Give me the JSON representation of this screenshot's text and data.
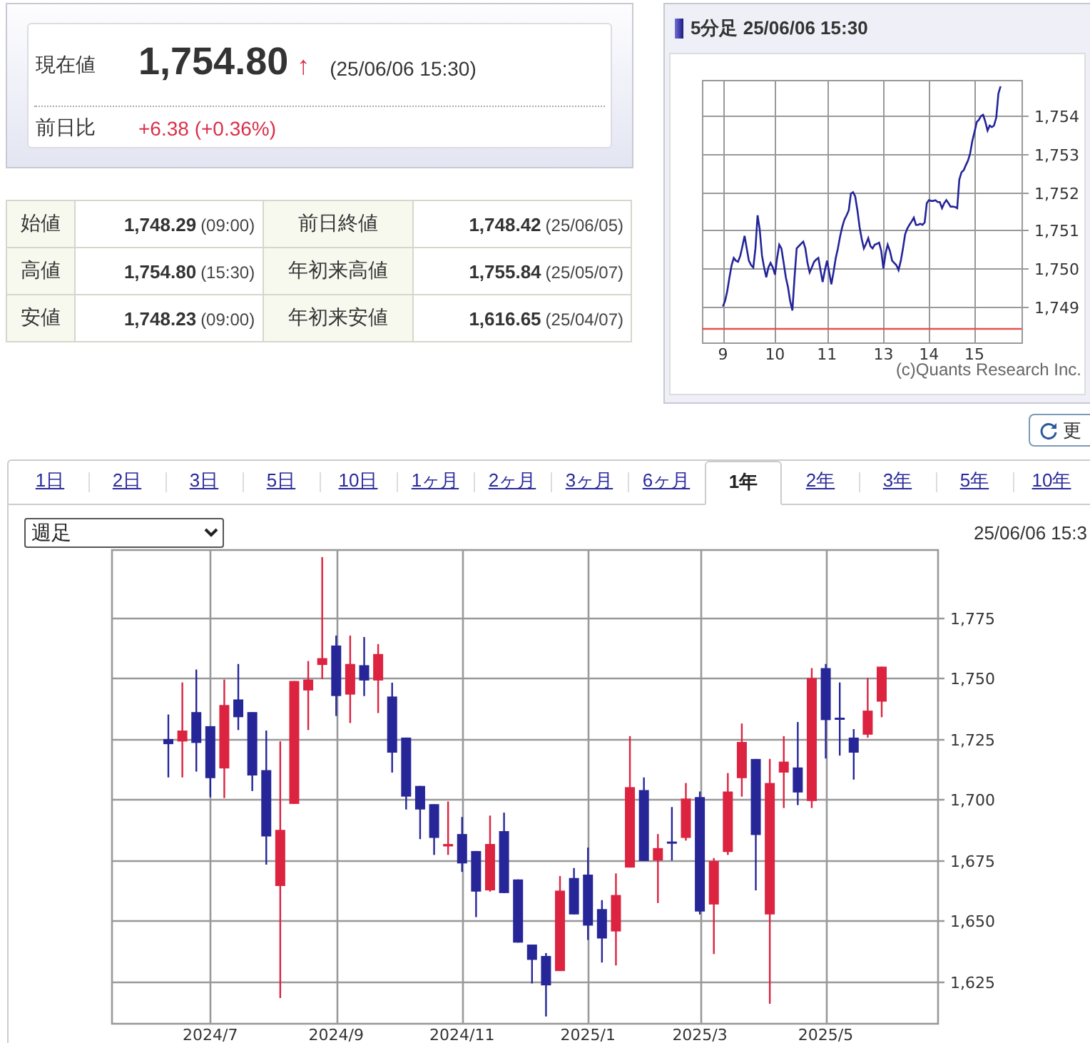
{
  "quote": {
    "label": "現在値",
    "price": "1,754.80",
    "arrow": "↑",
    "time": "(25/06/06 15:30)",
    "change_label": "前日比",
    "change": "+6.38 (+0.36%)"
  },
  "stats": [
    {
      "cells": [
        {
          "label": "始値",
          "value": "1,748.29",
          "time": "(09:00)"
        },
        {
          "label": "前日終値",
          "value": "1,748.42",
          "time": "(25/06/05)"
        }
      ]
    },
    {
      "cells": [
        {
          "label": "高値",
          "value": "1,754.80",
          "time": "(15:30)"
        },
        {
          "label": "年初来高値",
          "value": "1,755.84",
          "time": "(25/05/07)"
        }
      ]
    },
    {
      "cells": [
        {
          "label": "安値",
          "value": "1,748.23",
          "time": "(09:00)"
        },
        {
          "label": "年初来安値",
          "value": "1,616.65",
          "time": "(25/04/07)"
        }
      ]
    }
  ],
  "intraday": {
    "title": "5分足 25/06/06 15:30",
    "copyright": "(c)Quants Research Inc.",
    "chart_data": {
      "type": "line",
      "categories": [
        "9",
        null,
        null,
        null,
        null,
        null,
        null,
        null,
        null,
        null,
        null,
        null,
        null,
        null,
        null,
        null,
        null,
        null,
        null,
        null,
        null,
        null,
        null,
        null,
        "10",
        null,
        null,
        null,
        null,
        null,
        null,
        null,
        null,
        null,
        null,
        null,
        null,
        null,
        null,
        null,
        null,
        null,
        null,
        null,
        null,
        null,
        null,
        null,
        "11",
        null,
        null,
        null,
        null,
        null,
        null,
        null,
        null,
        null,
        null,
        null,
        null,
        null,
        null,
        null,
        null,
        null,
        null,
        null,
        null,
        null,
        null,
        null,
        null,
        null,
        "13",
        null,
        null,
        null,
        null,
        null,
        null,
        null,
        null,
        null,
        null,
        null,
        null,
        null,
        null,
        null,
        null,
        null,
        null,
        null,
        null,
        "14",
        null,
        null,
        null,
        null,
        null,
        null,
        null,
        null,
        null,
        null,
        null,
        null,
        null,
        null,
        null,
        null,
        null,
        null,
        null,
        null,
        "15",
        null,
        null,
        null,
        null,
        null,
        null,
        null,
        null,
        null,
        null,
        null,
        null
      ],
      "values": [
        1749.0,
        1749.14,
        1749.39,
        1749.76,
        1750.08,
        1750.27,
        1750.2,
        1750.17,
        1750.33,
        1750.58,
        1750.85,
        1750.52,
        1750.2,
        1750.08,
        1750.02,
        1750.52,
        1751.39,
        1751.02,
        1750.33,
        1750.02,
        1749.76,
        1750.02,
        1750.14,
        1750.02,
        1749.83,
        1750.27,
        1750.62,
        1750.52,
        1750.14,
        1749.76,
        1749.51,
        1749.14,
        1748.89,
        1749.76,
        1750.52,
        1750.58,
        1750.64,
        1750.7,
        1750.52,
        1750.14,
        1749.89,
        1750.02,
        1750.17,
        1750.23,
        1750.27,
        1749.95,
        1749.64,
        1749.95,
        1750.2,
        1749.89,
        1749.58,
        1749.89,
        1750.27,
        1750.52,
        1750.83,
        1751.08,
        1751.27,
        1751.39,
        1751.52,
        1751.96,
        1752.0,
        1751.89,
        1751.52,
        1751.08,
        1750.77,
        1750.52,
        1750.64,
        1750.79,
        1750.58,
        1750.52,
        1750.62,
        1750.64,
        1750.67,
        1750.45,
        1749.99,
        1750.39,
        1750.62,
        1750.45,
        1750.2,
        1750.14,
        1750.08,
        1749.95,
        1750.2,
        1750.52,
        1750.89,
        1751.04,
        1751.14,
        1751.23,
        1751.33,
        1751.14,
        1751.14,
        1751.17,
        1751.14,
        1751.2,
        1751.71,
        1751.79,
        1751.77,
        1751.77,
        1751.79,
        1751.74,
        1751.74,
        1751.58,
        1751.71,
        1751.79,
        1751.71,
        1751.62,
        1751.62,
        1751.61,
        1751.58,
        1752.33,
        1752.52,
        1752.58,
        1752.71,
        1752.83,
        1753.02,
        1753.34,
        1753.59,
        1753.84,
        1753.9,
        1754.0,
        1754.03,
        1753.84,
        1753.62,
        1753.75,
        1753.71,
        1753.75,
        1753.96,
        1754.59,
        1754.78
      ],
      "ylim": [
        1748.05,
        1754.95
      ],
      "grid": true,
      "yticks": [
        {
          "value": 1749,
          "label": "1,749"
        },
        {
          "value": 1750,
          "label": "1,750"
        },
        {
          "value": 1751,
          "label": "1,751"
        },
        {
          "value": 1752,
          "label": "1,752"
        },
        {
          "value": 1753,
          "label": "1,753"
        },
        {
          "value": 1754,
          "label": "1,754"
        }
      ],
      "ref_lines": [
        {
          "axis": "y",
          "value": 1748.42,
          "color": "#e85050"
        }
      ]
    }
  },
  "refresh_button": "更",
  "period_tabs": [
    {
      "label": "1日",
      "selected": false
    },
    {
      "label": "2日",
      "selected": false
    },
    {
      "label": "3日",
      "selected": false
    },
    {
      "label": "5日",
      "selected": false
    },
    {
      "label": "10日",
      "selected": false
    },
    {
      "label": "1ヶ月",
      "selected": false
    },
    {
      "label": "2ヶ月",
      "selected": false
    },
    {
      "label": "3ヶ月",
      "selected": false
    },
    {
      "label": "6ヶ月",
      "selected": false
    },
    {
      "label": "1年",
      "selected": true
    },
    {
      "label": "2年",
      "selected": false
    },
    {
      "label": "3年",
      "selected": false
    },
    {
      "label": "5年",
      "selected": false
    },
    {
      "label": "10年",
      "selected": false
    }
  ],
  "interval_select": {
    "value": "週足"
  },
  "timestamp": "25/06/06 15:3",
  "chart_data": {
    "type": "candlestick",
    "categories": [
      null,
      null,
      null,
      "2024/7",
      null,
      null,
      null,
      null,
      null,
      null,
      null,
      null,
      "2024/9",
      null,
      null,
      null,
      null,
      null,
      null,
      null,
      null,
      "2024/11",
      null,
      null,
      null,
      null,
      null,
      null,
      null,
      null,
      "2025/1",
      null,
      null,
      null,
      null,
      null,
      null,
      null,
      "2025/3",
      null,
      null,
      null,
      null,
      null,
      null,
      null,
      null,
      "2025/5",
      null,
      null,
      null,
      null
    ],
    "ohlc": [
      [
        1724.9,
        1735.0,
        1709.1,
        1722.8
      ],
      [
        1723.9,
        1748.2,
        1709.1,
        1728.4
      ],
      [
        1736.0,
        1753.5,
        1711.5,
        1723.3
      ],
      [
        1730.2,
        1730.2,
        1701.0,
        1708.8
      ],
      [
        1712.8,
        1749.4,
        1700.6,
        1738.9
      ],
      [
        1741.2,
        1755.8,
        1728.6,
        1733.9
      ],
      [
        1736.0,
        1736.0,
        1703.5,
        1709.9
      ],
      [
        1712.1,
        1728.4,
        1673.2,
        1684.8
      ],
      [
        1664.4,
        1723.9,
        1618.3,
        1687.5
      ],
      [
        1698.2,
        1748.8,
        1698.2,
        1748.8
      ],
      [
        1744.9,
        1757.0,
        1728.6,
        1749.4
      ],
      [
        1755.4,
        1799.8,
        1749.6,
        1758.2
      ],
      [
        1763.4,
        1767.5,
        1734.4,
        1742.6
      ],
      [
        1743.2,
        1767.5,
        1731.5,
        1755.8
      ],
      [
        1755.3,
        1766.9,
        1742.6,
        1749.0
      ],
      [
        1749.0,
        1764.0,
        1735.6,
        1759.9
      ],
      [
        1742.4,
        1748.1,
        1711.1,
        1719.3
      ],
      [
        1725.5,
        1725.5,
        1695.9,
        1701.2
      ],
      [
        1705.6,
        1705.6,
        1683.7,
        1695.9
      ],
      [
        1698.1,
        1698.1,
        1677.2,
        1684.2
      ],
      [
        1680.7,
        1699.2,
        1677.2,
        1681.7
      ],
      [
        1685.8,
        1692.8,
        1670.2,
        1673.7
      ],
      [
        1678.8,
        1678.8,
        1651.6,
        1662.1
      ],
      [
        1662.6,
        1693.4,
        1662.1,
        1681.7
      ],
      [
        1687.0,
        1694.6,
        1661.5,
        1661.5
      ],
      [
        1667.1,
        1667.1,
        1641.1,
        1641.1
      ],
      [
        1640.3,
        1640.3,
        1624.3,
        1634.0
      ],
      [
        1635.6,
        1636.8,
        1610.7,
        1623.5
      ],
      [
        1629.4,
        1668.5,
        1629.4,
        1662.5
      ],
      [
        1667.7,
        1671.8,
        1652.7,
        1652.7
      ],
      [
        1669.1,
        1680.2,
        1642.2,
        1648.1
      ],
      [
        1654.9,
        1658.6,
        1632.9,
        1642.8
      ],
      [
        1645.7,
        1669.6,
        1631.7,
        1660.7
      ],
      [
        1672.0,
        1726.1,
        1672.0,
        1705.1
      ],
      [
        1703.9,
        1709.1,
        1674.7,
        1674.7
      ],
      [
        1674.9,
        1685.8,
        1657.4,
        1680.0
      ],
      [
        1682.7,
        1696.9,
        1674.9,
        1681.9
      ],
      [
        1684.2,
        1706.8,
        1683.1,
        1700.4
      ],
      [
        1701.0,
        1703.3,
        1652.7,
        1653.9
      ],
      [
        1656.8,
        1675.9,
        1636.4,
        1674.7
      ],
      [
        1678.4,
        1710.9,
        1677.2,
        1703.3
      ],
      [
        1708.8,
        1731.3,
        1701.2,
        1723.7
      ],
      [
        1716.7,
        1716.7,
        1662.6,
        1685.4
      ],
      [
        1652.7,
        1716.7,
        1615.9,
        1706.8
      ],
      [
        1711.1,
        1726.1,
        1696.5,
        1715.6
      ],
      [
        1713.2,
        1731.9,
        1697.7,
        1702.9
      ],
      [
        1699.4,
        1754.1,
        1696.5,
        1750.0
      ],
      [
        1754.1,
        1755.8,
        1716.9,
        1732.7
      ],
      [
        1733.7,
        1748.2,
        1718.1,
        1733.3
      ],
      [
        1725.5,
        1729.0,
        1708.2,
        1719.3
      ],
      [
        1726.7,
        1750.0,
        1725.5,
        1736.6
      ],
      [
        1740.3,
        1754.7,
        1733.9,
        1754.7
      ]
    ],
    "ylim": [
      1608,
      1803
    ],
    "grid": true,
    "yticks": [
      {
        "value": 1625,
        "label": "1,625"
      },
      {
        "value": 1650,
        "label": "1,650"
      },
      {
        "value": 1675,
        "label": "1,675"
      },
      {
        "value": 1700,
        "label": "1,700"
      },
      {
        "value": 1725,
        "label": "1,725"
      },
      {
        "value": 1750,
        "label": "1,750"
      },
      {
        "value": 1775,
        "label": "1,775"
      }
    ]
  }
}
